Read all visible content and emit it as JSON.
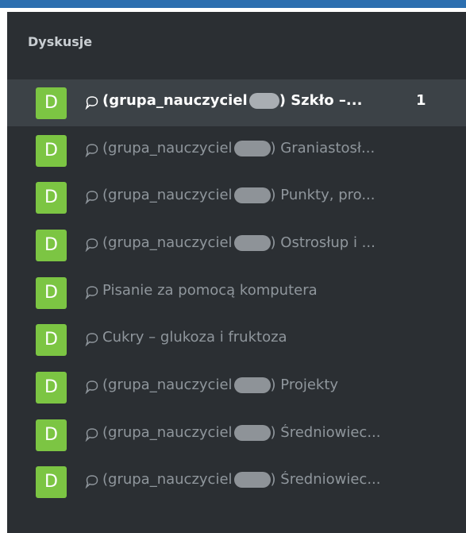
{
  "header": {
    "title": "Dyskusje"
  },
  "colors": {
    "topbar": "#2c6fb0",
    "panel": "#2b2f33",
    "active_row": "#3c4247",
    "avatar": "#7cc543"
  },
  "conversations": [
    {
      "avatar": "D",
      "prefix": "(grupa_nauczyciel",
      "suffix": ") Szkło –...",
      "unread": "1",
      "active": true
    },
    {
      "avatar": "D",
      "prefix": "(grupa_nauczyciel",
      "suffix": ") Graniastosł...",
      "active": false
    },
    {
      "avatar": "D",
      "prefix": "(grupa_nauczyciel",
      "suffix": ") Punkty, pro...",
      "active": false
    },
    {
      "avatar": "D",
      "prefix": "(grupa_nauczyciel",
      "suffix": ") Ostrosłup i ...",
      "active": false
    },
    {
      "avatar": "D",
      "prefix": "",
      "suffix": "Pisanie za pomocą komputera",
      "active": false
    },
    {
      "avatar": "D",
      "prefix": "",
      "suffix": "Cukry – glukoza i fruktoza",
      "active": false
    },
    {
      "avatar": "D",
      "prefix": "(grupa_nauczyciel",
      "suffix": ") Projekty",
      "active": false
    },
    {
      "avatar": "D",
      "prefix": "(grupa_nauczyciel",
      "suffix": ") Średniowiec...",
      "active": false
    },
    {
      "avatar": "D",
      "prefix": "(grupa_nauczyciel",
      "suffix": ") Średniowiec...",
      "active": false
    }
  ]
}
